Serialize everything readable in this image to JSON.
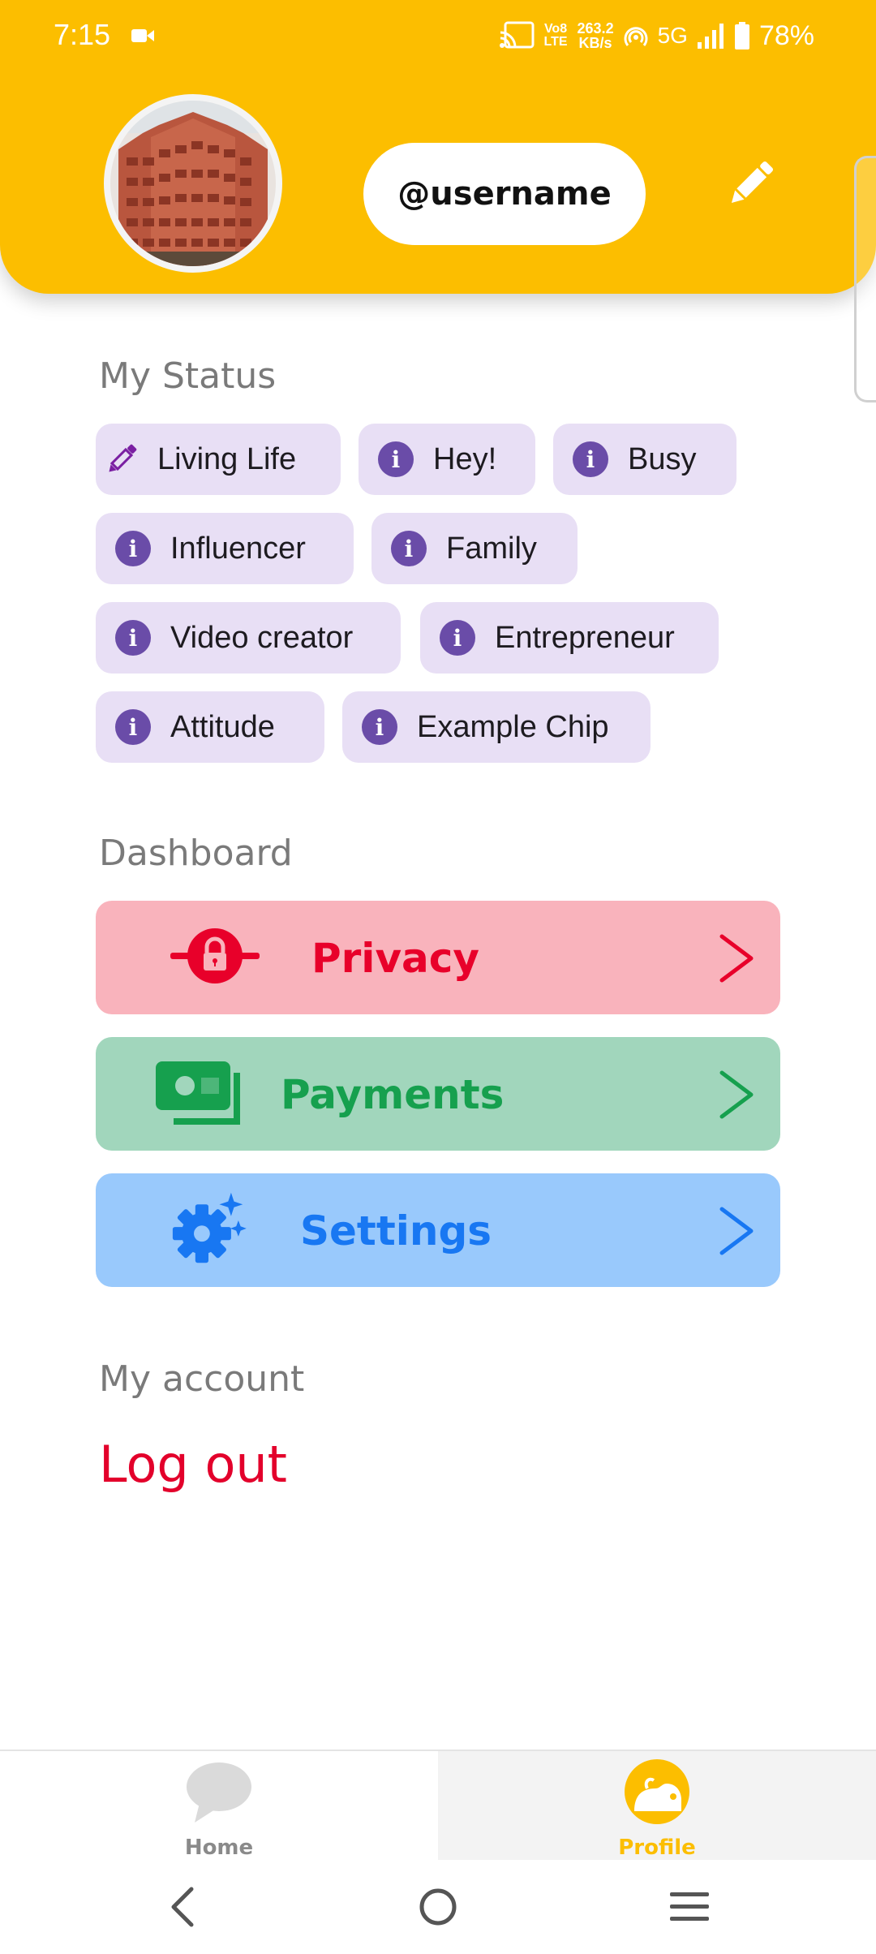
{
  "status_bar": {
    "time": "7:15",
    "volte": "Vo8",
    "lte": "LTE",
    "rate_value": "263.2",
    "rate_unit": "KB/s",
    "network": "5G",
    "battery": "78%"
  },
  "header": {
    "username": "@username",
    "avatar_icon": "profile-photo",
    "edit_icon": "pencil-icon",
    "background_color": "#FCBE00"
  },
  "status_section": {
    "title": "My Status",
    "chips": [
      {
        "label": "Living Life",
        "icon": "pencil-icon"
      },
      {
        "label": "Hey!",
        "icon": "info-icon"
      },
      {
        "label": "Busy",
        "icon": "info-icon"
      },
      {
        "label": "Influencer",
        "icon": "info-icon"
      },
      {
        "label": "Family",
        "icon": "info-icon"
      },
      {
        "label": "Video creator",
        "icon": "info-icon"
      },
      {
        "label": "Entrepreneur",
        "icon": "info-icon"
      },
      {
        "label": "Attitude",
        "icon": "info-icon"
      },
      {
        "label": "Example Chip",
        "icon": "info-icon"
      }
    ]
  },
  "dashboard": {
    "title": "Dashboard",
    "items": [
      {
        "label": "Privacy",
        "icon": "lock-icon",
        "bg": "#F9B3BC",
        "fg": "#E8002A"
      },
      {
        "label": "Payments",
        "icon": "money-icon",
        "bg": "#A1D6BC",
        "fg": "#16A04E"
      },
      {
        "label": "Settings",
        "icon": "gear-sparkle-icon",
        "bg": "#99C9FC",
        "fg": "#1877F2"
      }
    ]
  },
  "account": {
    "title": "My account",
    "logout_label": "Log out"
  },
  "bottom_nav": {
    "items": [
      {
        "label": "Home",
        "icon": "chat-bubble-icon",
        "active": false
      },
      {
        "label": "Profile",
        "icon": "profile-face-icon",
        "active": true
      }
    ],
    "active_color": "#FCBE00"
  },
  "system_nav": {
    "back": "back-icon",
    "home": "home-circle-icon",
    "recents": "menu-icon"
  }
}
